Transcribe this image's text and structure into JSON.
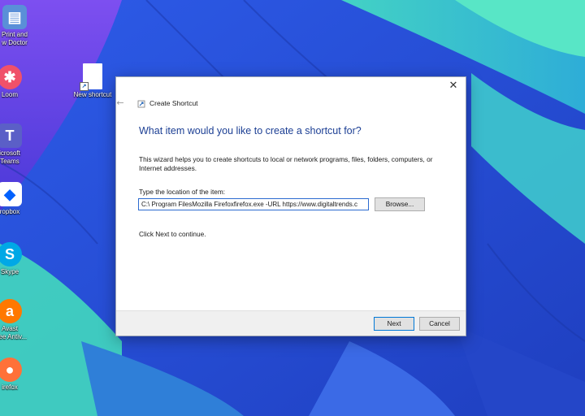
{
  "desktop": {
    "icons": [
      {
        "name": "print-and-new-doctor",
        "label": "Print and\nw Doctor",
        "color": "#5a8fd8",
        "glyph": "📄"
      },
      {
        "name": "loom",
        "label": "Loom",
        "color": "#f0516a",
        "glyph": "✱"
      },
      {
        "name": "microsoft-teams",
        "label": "icrosoft\nTeams",
        "color": "#5b5fc7",
        "glyph": "T"
      },
      {
        "name": "dropbox",
        "label": "ropbox",
        "color": "#0061fe",
        "glyph": "◆"
      },
      {
        "name": "skype",
        "label": "Skype",
        "color": "#00a8e6",
        "glyph": "S"
      },
      {
        "name": "avast",
        "label": "Avast\nFree Antiv...",
        "color": "#ff7800",
        "glyph": "a"
      },
      {
        "name": "firefox",
        "label": "irefox",
        "color": "#ff7139",
        "glyph": "●"
      },
      {
        "name": "new-shortcut",
        "label": "New shortcut",
        "color": "#ffffff",
        "glyph": ""
      }
    ]
  },
  "dialog": {
    "close_glyph": "✕",
    "back_glyph": "←",
    "title": "Create Shortcut",
    "heading": "What item would you like to create a shortcut for?",
    "description": "This wizard helps you to create shortcuts to local or network programs, files, folders, computers, or Internet addresses.",
    "location_label": "Type the location of the item:",
    "location_value": "C:\\ Program FilesMozilla Firefoxfirefox.exe -URL https://www.digitaltrends.c",
    "browse_label": "Browse...",
    "hint": "Click Next to continue.",
    "next_label": "Next",
    "cancel_label": "Cancel"
  },
  "colors": {
    "heading": "#1c3f94",
    "desktop_blue": "#2a4fd0",
    "desktop_teal": "#3fd4c8"
  }
}
